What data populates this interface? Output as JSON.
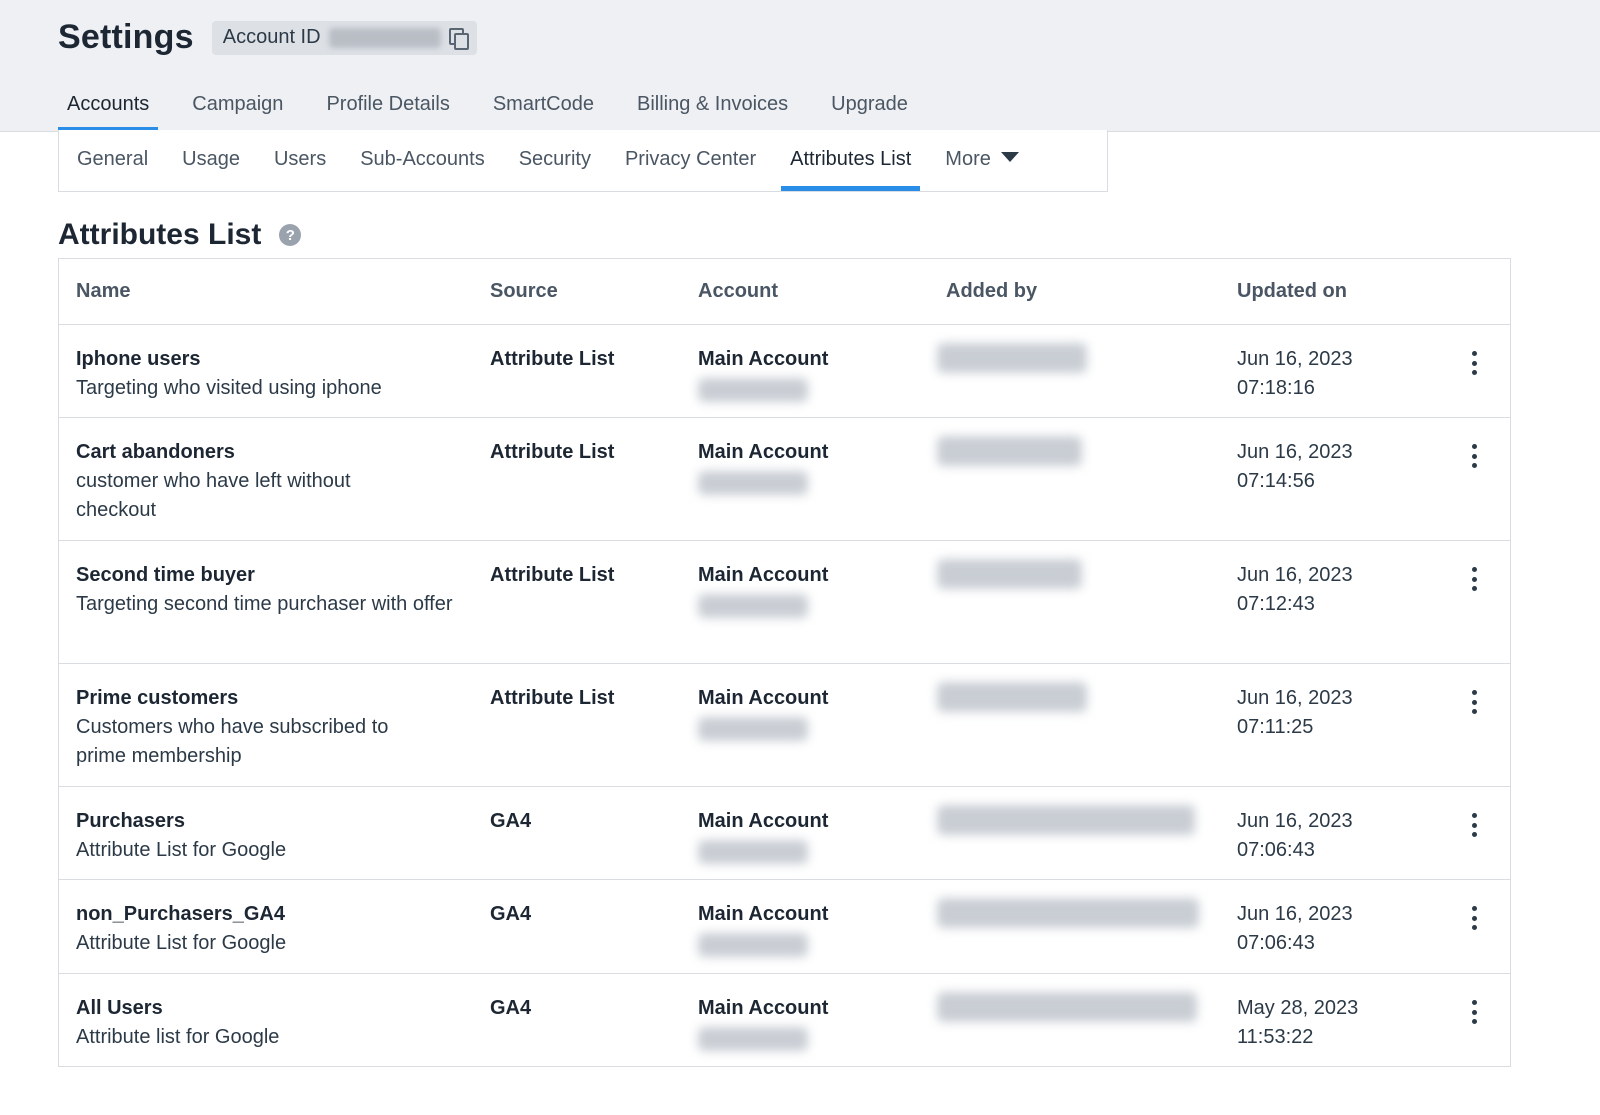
{
  "header": {
    "title": "Settings",
    "account_id_label": "Account ID"
  },
  "main_tabs": [
    {
      "label": "Accounts",
      "active": true
    },
    {
      "label": "Campaign",
      "active": false
    },
    {
      "label": "Profile Details",
      "active": false
    },
    {
      "label": "SmartCode",
      "active": false
    },
    {
      "label": "Billing & Invoices",
      "active": false
    },
    {
      "label": "Upgrade",
      "active": false
    }
  ],
  "sub_tabs": [
    {
      "label": "General",
      "active": false
    },
    {
      "label": "Usage",
      "active": false
    },
    {
      "label": "Users",
      "active": false
    },
    {
      "label": "Sub-Accounts",
      "active": false
    },
    {
      "label": "Security",
      "active": false
    },
    {
      "label": "Privacy Center",
      "active": false
    },
    {
      "label": "Attributes List",
      "active": true
    },
    {
      "label": "More",
      "active": false
    }
  ],
  "section": {
    "title": "Attributes List",
    "help_icon": "?"
  },
  "table": {
    "columns": [
      "Name",
      "Source",
      "Account",
      "Added by",
      "Updated on"
    ],
    "rows": [
      {
        "name": "Iphone users",
        "description": "Targeting who visited using iphone",
        "source": "Attribute List",
        "account": "Main Account",
        "date": "Jun 16, 2023",
        "time": "07:18:16"
      },
      {
        "name": "Cart abandoners",
        "description": "customer who have left without checkout",
        "source": "Attribute List",
        "account": "Main Account",
        "date": "Jun 16, 2023",
        "time": "07:14:56"
      },
      {
        "name": "Second time buyer",
        "description": "Targeting second time purchaser with offer",
        "source": "Attribute List",
        "account": "Main Account",
        "date": "Jun 16, 2023",
        "time": "07:12:43"
      },
      {
        "name": "Prime customers",
        "description": "Customers who have subscribed to prime membership",
        "source": "Attribute List",
        "account": "Main Account",
        "date": "Jun 16, 2023",
        "time": "07:11:25"
      },
      {
        "name": "Purchasers",
        "description": "Attribute List for Google",
        "source": "GA4",
        "account": "Main Account",
        "date": "Jun 16, 2023",
        "time": "07:06:43"
      },
      {
        "name": "non_Purchasers_GA4",
        "description": "Attribute List for Google",
        "source": "GA4",
        "account": "Main Account",
        "date": "Jun 16, 2023",
        "time": "07:06:43"
      },
      {
        "name": "All Users",
        "description": "Attribute list for Google",
        "source": "GA4",
        "account": "Main Account",
        "date": "May 28, 2023",
        "time": "11:53:22"
      }
    ]
  },
  "icons": {
    "copy": "copy-icon",
    "help": "help-icon",
    "more_caret": "caret-down-icon",
    "row_menu": "kebab-menu-icon"
  },
  "colors": {
    "accent": "#2a8ee8",
    "header_bg": "#eef0f3",
    "border": "#d9dde2",
    "text_dark": "#1d2733"
  }
}
